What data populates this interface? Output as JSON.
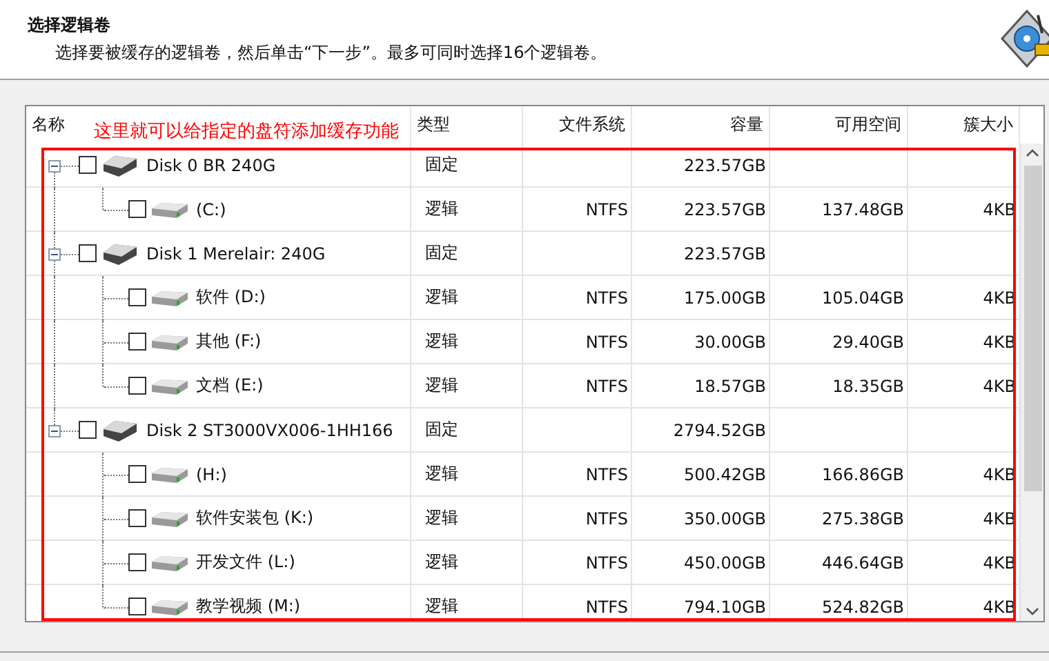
{
  "header": {
    "title": "选择逻辑卷",
    "subtitle": "选择要被缓存的逻辑卷，然后单击“下一步”。最多可同时选择16个逻辑卷。"
  },
  "annotation": "这里就可以给指定的盘符添加缓存功能",
  "columns": [
    "名称",
    "类型",
    "文件系统",
    "容量",
    "可用空间",
    "簇大小"
  ],
  "disks": [
    {
      "name": "Disk 0 BR 240G",
      "type": "固定",
      "capacity": "223.57GB",
      "expanded": true,
      "checked": false,
      "volumes": [
        {
          "name": "(C:)",
          "type": "逻辑",
          "filesystem": "NTFS",
          "capacity": "223.57GB",
          "free": "137.48GB",
          "cluster": "4KB",
          "checked": false
        }
      ]
    },
    {
      "name": "Disk 1 Merelair: 240G",
      "type": "固定",
      "capacity": "223.57GB",
      "expanded": true,
      "checked": false,
      "volumes": [
        {
          "name": "软件 (D:)",
          "type": "逻辑",
          "filesystem": "NTFS",
          "capacity": "175.00GB",
          "free": "105.04GB",
          "cluster": "4KB",
          "checked": false
        },
        {
          "name": "其他 (F:)",
          "type": "逻辑",
          "filesystem": "NTFS",
          "capacity": "30.00GB",
          "free": "29.40GB",
          "cluster": "4KB",
          "checked": false
        },
        {
          "name": "文档 (E:)",
          "type": "逻辑",
          "filesystem": "NTFS",
          "capacity": "18.57GB",
          "free": "18.35GB",
          "cluster": "4KB",
          "checked": false
        }
      ]
    },
    {
      "name": "Disk 2 ST3000VX006-1HH166",
      "type": "固定",
      "capacity": "2794.52GB",
      "expanded": true,
      "checked": false,
      "volumes": [
        {
          "name": "(H:)",
          "type": "逻辑",
          "filesystem": "NTFS",
          "capacity": "500.42GB",
          "free": "166.86GB",
          "cluster": "4KB",
          "checked": false
        },
        {
          "name": "软件安装包 (K:)",
          "type": "逻辑",
          "filesystem": "NTFS",
          "capacity": "350.00GB",
          "free": "275.38GB",
          "cluster": "4KB",
          "checked": false
        },
        {
          "name": "开发文件 (L:)",
          "type": "逻辑",
          "filesystem": "NTFS",
          "capacity": "450.00GB",
          "free": "446.64GB",
          "cluster": "4KB",
          "checked": false
        },
        {
          "name": "教学视频 (M:)",
          "type": "逻辑",
          "filesystem": "NTFS",
          "capacity": "794.10GB",
          "free": "524.82GB",
          "cluster": "4KB",
          "checked": false
        }
      ]
    }
  ]
}
